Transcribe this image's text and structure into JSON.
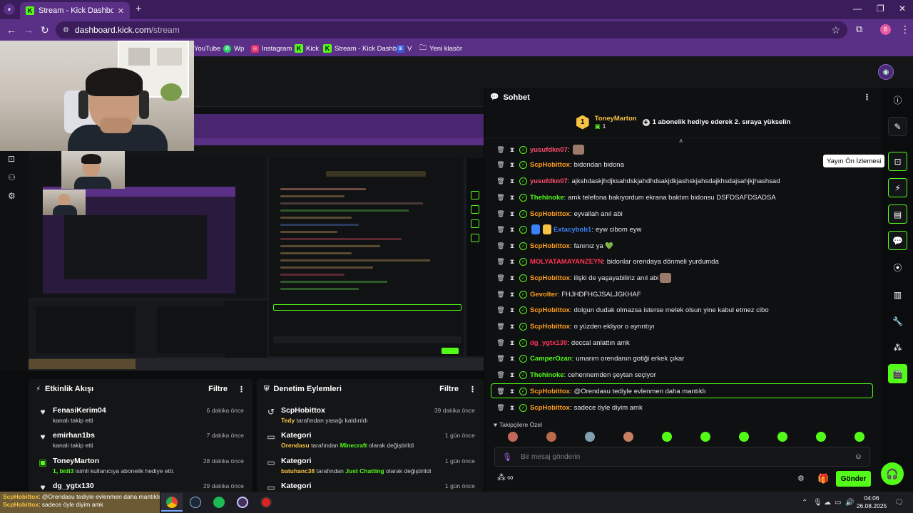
{
  "browser": {
    "tab_title": "Stream - Kick Dashboard",
    "url_host": "dashboard.kick.com",
    "url_path": "/stream",
    "bookmarks": [
      {
        "label": "YouTube",
        "color": "#ff0000"
      },
      {
        "label": "Wp",
        "color": "#25d366"
      },
      {
        "label": "Instagram",
        "color": "#e1306c"
      },
      {
        "label": "Kick",
        "color": "#53fc18"
      },
      {
        "label": "Stream - Kick Dashb...",
        "color": "#53fc18"
      },
      {
        "label": "V",
        "color": "#3b5bdb"
      },
      {
        "label": "Yeni klasör",
        "color": "#888888"
      }
    ],
    "profile_initial": "B"
  },
  "activity": {
    "title": "Etkinlik Akışı",
    "filter": "Filtre",
    "items": [
      {
        "icon": "heart-icon",
        "name": "FenasiKerim04",
        "sub": "kanalı takip etti",
        "time": "6 dakika önce"
      },
      {
        "icon": "heart-icon",
        "name": "emirhan1bs",
        "sub": "kanalı takip etti",
        "time": "7 dakika önce"
      },
      {
        "icon": "gift-icon",
        "name": "ToneyMarton",
        "sub_prefix": "1,",
        "sub_user": "bidi3",
        "sub": "isimli kullanıcıya abonelik hediye etti.",
        "time": "28 dakika önce"
      },
      {
        "icon": "heart-icon",
        "name": "dg_ygtx130",
        "sub": "",
        "time": "29 dakika önce"
      }
    ]
  },
  "moderation": {
    "title": "Denetim Eylemleri",
    "filter": "Filtre",
    "items": [
      {
        "icon": "undo-icon",
        "name": "ScpHobittox",
        "user": "Tedy",
        "sub": "tarafından yasağı kaldırıldı",
        "time": "39 dakika önce"
      },
      {
        "icon": "category-icon",
        "name": "Kategori",
        "user": "Orendasu",
        "mid": "tarafından",
        "cat": "Minecraft",
        "sub": "olarak değiştirildi",
        "time": "1 gün önce"
      },
      {
        "icon": "category-icon",
        "name": "Kategori",
        "user": "batuhanc38",
        "mid": "tarafından",
        "cat": "Just Chatting",
        "sub": "olarak değiştirildi",
        "time": "1 gün önce"
      },
      {
        "icon": "category-icon",
        "name": "Kategori",
        "user": "",
        "mid": "",
        "cat": "",
        "sub": "",
        "time": "1 gün önce"
      }
    ]
  },
  "chat": {
    "title": "Sohbet",
    "pinned": {
      "name": "ToneyMarton",
      "count": "1",
      "badge": "1",
      "message": "1 abonelik hediye ederek 2. sıraya yükselin"
    },
    "messages": [
      {
        "user": "yusufdkn07",
        "color": "#ff4d6d",
        "text": "",
        "emote": true
      },
      {
        "user": "ScpHobittox",
        "color": "#ff9f1c",
        "text": "bidondan bidona"
      },
      {
        "user": "yusufdkn07",
        "color": "#ff4d6d",
        "text": "ajkshdaskjhdjksahdskjahdhdsakjdkjashskjahsdajkhsdajsahjkjhashsad"
      },
      {
        "user": "Thehinoke",
        "color": "#53fc18",
        "text": "amk telefona bakıyordum ekrana baktım bidonsu DSFDSAFDSADSA"
      },
      {
        "user": "ScpHobittox",
        "color": "#ff9f1c",
        "text": "eyvallah anıl abi"
      },
      {
        "user": "Extacybob1",
        "color": "#3b82f6",
        "text": "eyw cibom eyw",
        "badges": true
      },
      {
        "user": "ScpHobittox",
        "color": "#ff9f1c",
        "text": "fanınız ya 💚"
      },
      {
        "user": "MOLYATAMAYANZEYN",
        "color": "#ff3355",
        "text": "bidonlar orendaya dönmeli yurdumda"
      },
      {
        "user": "ScpHobittox",
        "color": "#ff9f1c",
        "text": "ilişki de yaşayabiliriz anıl abi",
        "emote": true
      },
      {
        "user": "Gevolter",
        "color": "#ff9f1c",
        "text": "FHJHDFHGJSALJGKHAF"
      },
      {
        "user": "ScpHobittox",
        "color": "#ff9f1c",
        "text": "dolgun dudak olmazsa isterse melek olsun yine kabul etmez cibo"
      },
      {
        "user": "ScpHobittox",
        "color": "#ff9f1c",
        "text": "o yüzden ekliyor o ayrıntıyı"
      },
      {
        "user": "dg_ygtx130",
        "color": "#ff3355",
        "text": "deccal anlattın amk"
      },
      {
        "user": "CamperOzan",
        "color": "#53fc18",
        "text": "umarım orendanın gotiği erkek çıkar"
      },
      {
        "user": "Thehinoke",
        "color": "#53fc18",
        "text": "cehennemden şeytan seçiyor"
      },
      {
        "user": "ScpHobittox",
        "color": "#ff9f1c",
        "text": "@Orendasu tediyle evlenmen daha mantıklı"
      },
      {
        "user": "ScpHobittox",
        "color": "#ff9f1c",
        "text": "sadece öyle diyim amk"
      }
    ],
    "follow_only": "Takipçilere Özel",
    "input_placeholder": "Bir mesaj gönderin",
    "send_label": "Gönder"
  },
  "rail": {
    "tooltip": "Yayın Ön İzlemesi"
  },
  "taskbar": {
    "time": "04:06",
    "date": "26.08.2025",
    "overlay_line1_user": "ScpHobittox",
    "overlay_line1_text": "@Orendasu tediyle evlenmen daha mantıklı",
    "overlay_line2_user": "ScpHobittox",
    "overlay_line2_text": "sadece öyle diyim amk"
  }
}
